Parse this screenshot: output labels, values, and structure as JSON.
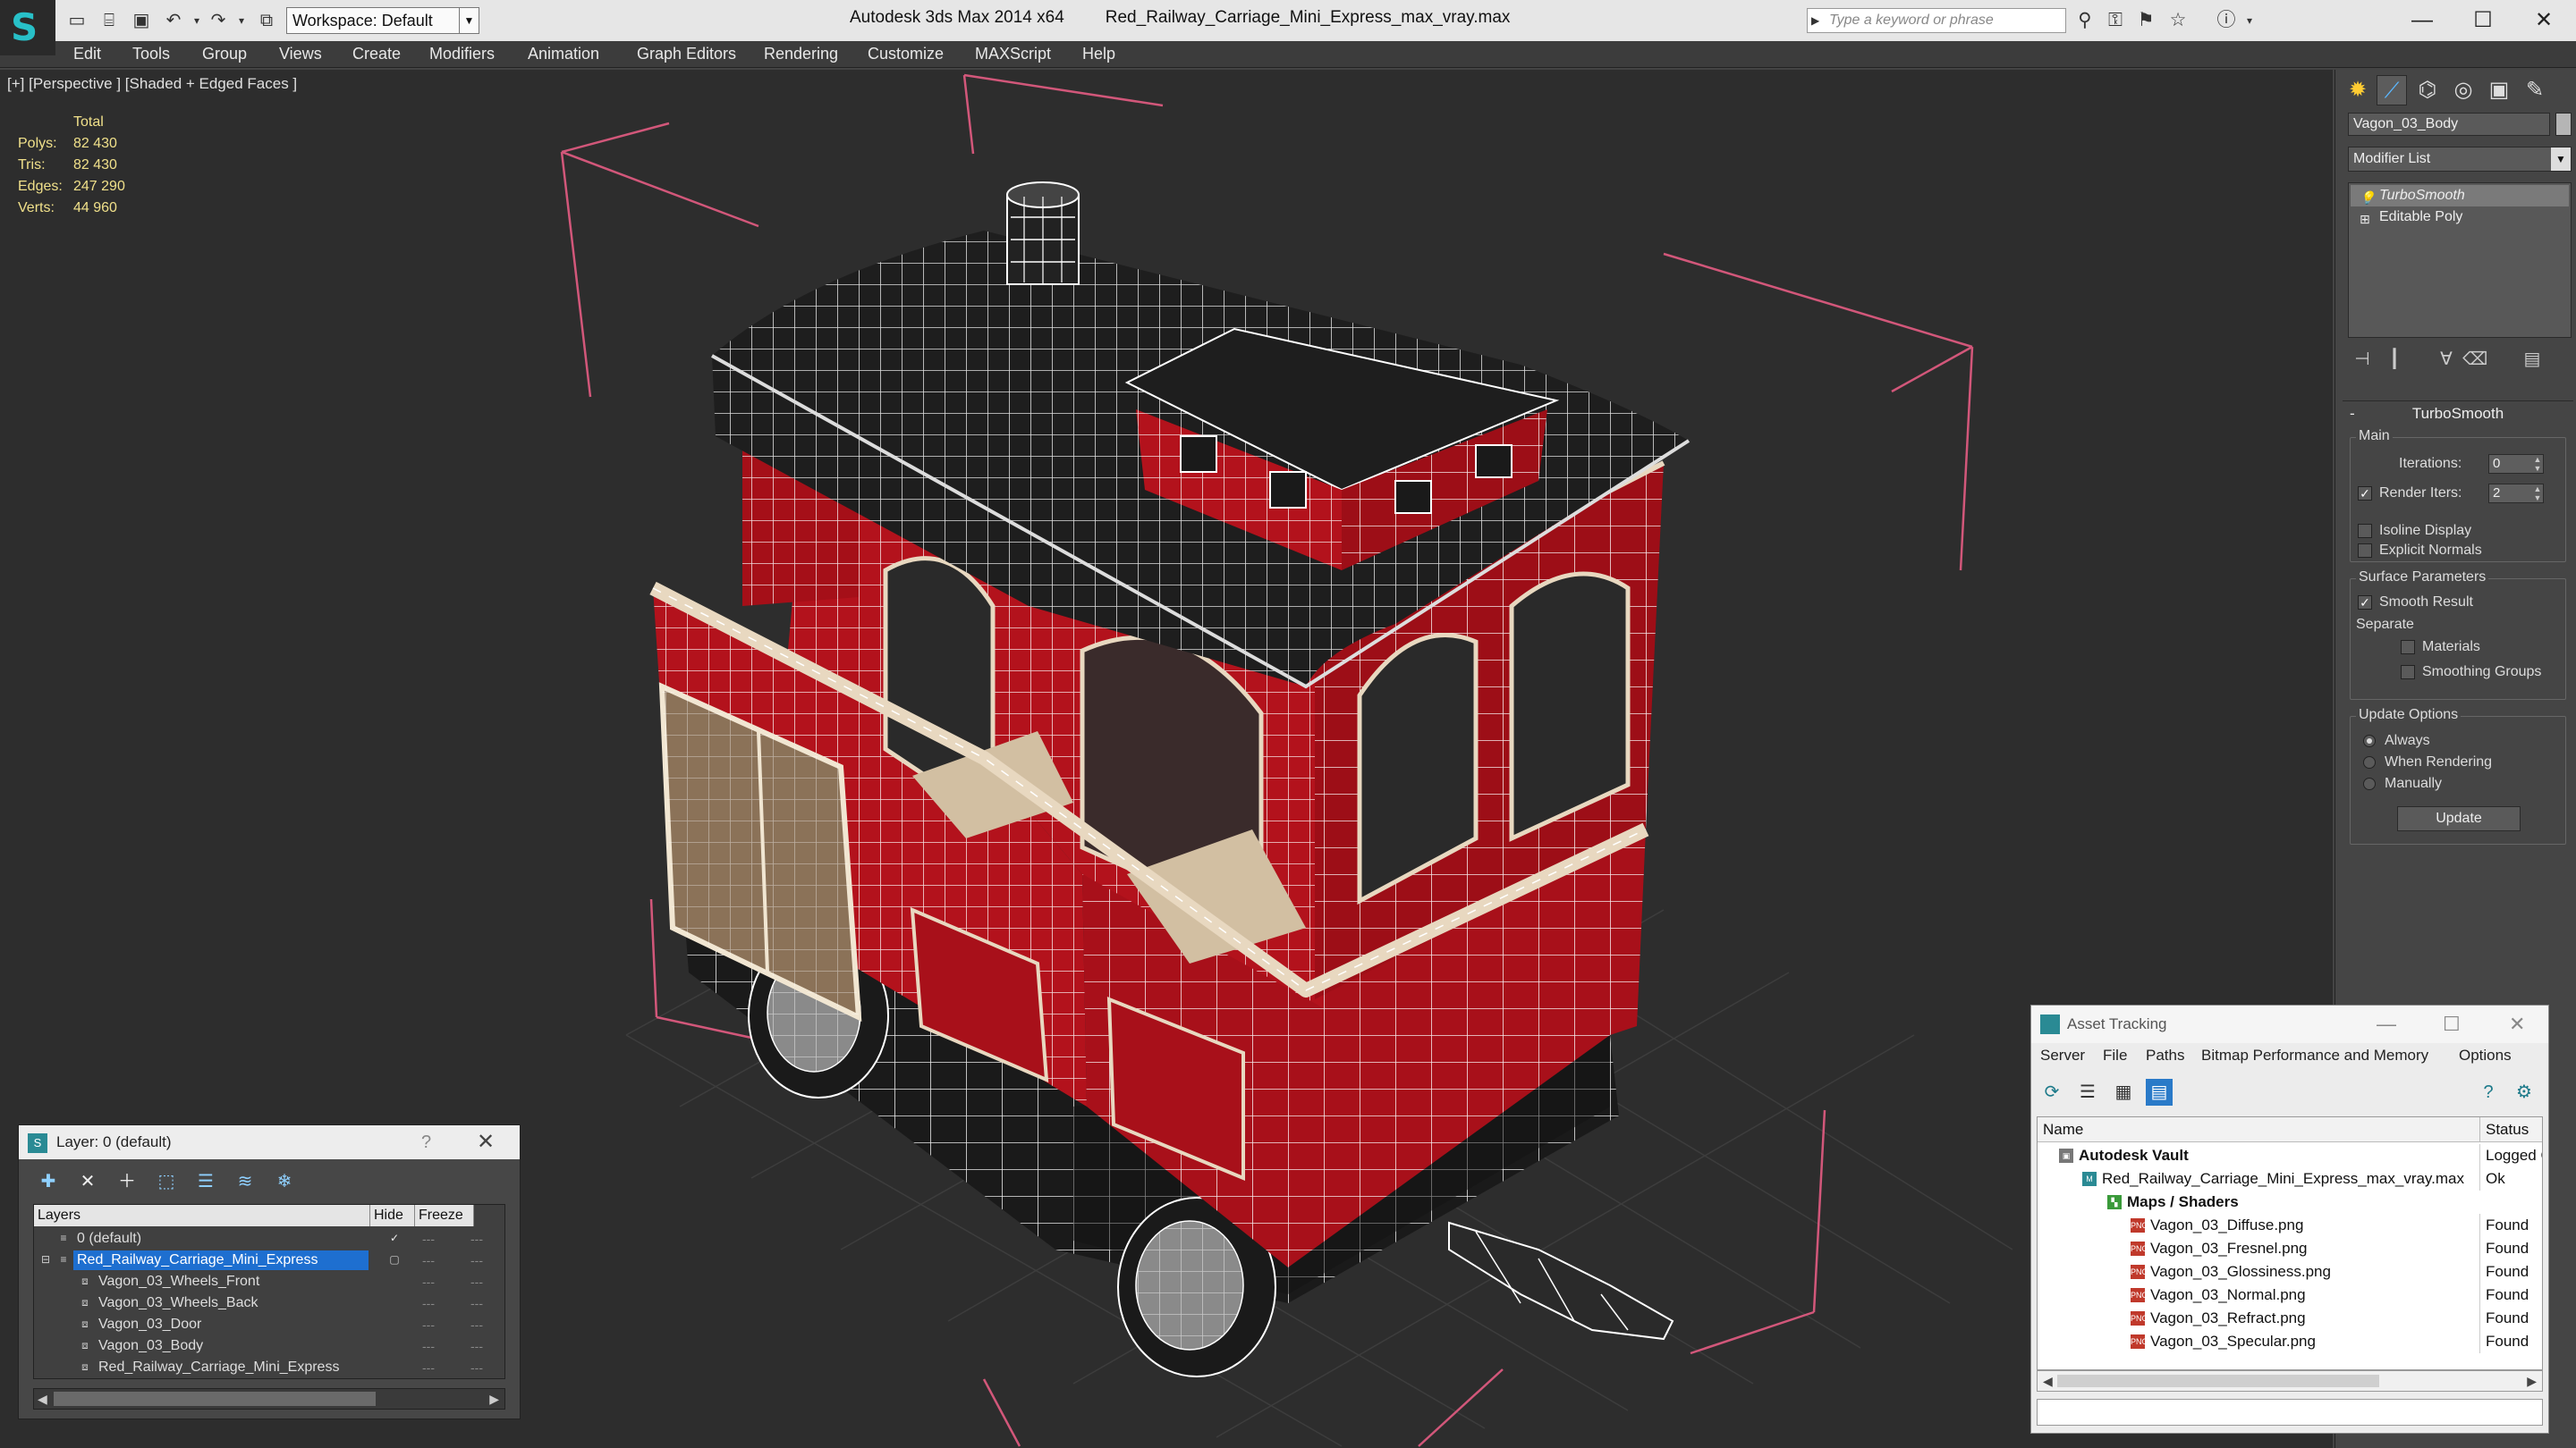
{
  "app": {
    "title_app": "Autodesk 3ds Max  2014 x64",
    "title_file": "Red_Railway_Carriage_Mini_Express_max_vray.max",
    "workspace": "Workspace: Default",
    "search_placeholder": "Type a keyword or phrase"
  },
  "menu": [
    "Edit",
    "Tools",
    "Group",
    "Views",
    "Create",
    "Modifiers",
    "Animation",
    "Graph Editors",
    "Rendering",
    "Customize",
    "MAXScript",
    "Help"
  ],
  "viewport": {
    "label": "[+] [Perspective ] [Shaded + Edged Faces ]",
    "stats_header": "Total",
    "stats": [
      {
        "key": "Polys:",
        "value": "82 430"
      },
      {
        "key": "Tris:",
        "value": "82 430"
      },
      {
        "key": "Edges:",
        "value": "247 290"
      },
      {
        "key": "Verts:",
        "value": "44 960"
      }
    ]
  },
  "command_panel": {
    "object_name": "Vagon_03_Body",
    "modifier_list": "Modifier List",
    "stack": [
      {
        "label": "TurboSmooth",
        "selected": true
      },
      {
        "label": "Editable Poly",
        "selected": false
      }
    ],
    "rollout_title": "TurboSmooth",
    "main_group": "Main",
    "iterations_label": "Iterations:",
    "iterations_value": "0",
    "render_iters_label": "Render Iters:",
    "render_iters_value": "2",
    "isoline_label": "Isoline Display",
    "explicit_label": "Explicit Normals",
    "surface_group": "Surface Parameters",
    "smooth_label": "Smooth Result",
    "separate_label": "Separate",
    "materials_label": "Materials",
    "smoothing_groups_label": "Smoothing Groups",
    "update_group": "Update Options",
    "always_label": "Always",
    "when_rendering_label": "When Rendering",
    "manually_label": "Manually",
    "update_button": "Update"
  },
  "layer_window": {
    "title": "Layer: 0 (default)",
    "help": "?",
    "col_layers": "Layers",
    "col_hide": "Hide",
    "col_freeze": "Freeze",
    "rows": [
      {
        "name": "0 (default)",
        "indent": 0,
        "selected": false
      },
      {
        "name": "Red_Railway_Carriage_Mini_Express",
        "indent": 0,
        "selected": true
      },
      {
        "name": "Vagon_03_Wheels_Front",
        "indent": 1,
        "selected": false
      },
      {
        "name": "Vagon_03_Wheels_Back",
        "indent": 1,
        "selected": false
      },
      {
        "name": "Vagon_03_Door",
        "indent": 1,
        "selected": false
      },
      {
        "name": "Vagon_03_Body",
        "indent": 1,
        "selected": false
      },
      {
        "name": "Red_Railway_Carriage_Mini_Express",
        "indent": 1,
        "selected": false
      }
    ]
  },
  "asset_window": {
    "title": "Asset Tracking",
    "menu": [
      "Server",
      "File",
      "Paths",
      "Bitmap Performance and Memory",
      "Options"
    ],
    "col_name": "Name",
    "col_status": "Status",
    "rows": [
      {
        "name": "Autodesk Vault",
        "status": "Logged C",
        "level": 0
      },
      {
        "name": "Red_Railway_Carriage_Mini_Express_max_vray.max",
        "status": "Ok",
        "level": 1
      },
      {
        "name": "Maps / Shaders",
        "status": "",
        "level": 2
      },
      {
        "name": "Vagon_03_Diffuse.png",
        "status": "Found",
        "level": 3
      },
      {
        "name": "Vagon_03_Fresnel.png",
        "status": "Found",
        "level": 3
      },
      {
        "name": "Vagon_03_Glossiness.png",
        "status": "Found",
        "level": 3
      },
      {
        "name": "Vagon_03_Normal.png",
        "status": "Found",
        "level": 3
      },
      {
        "name": "Vagon_03_Refract.png",
        "status": "Found",
        "level": 3
      },
      {
        "name": "Vagon_03_Specular.png",
        "status": "Found",
        "level": 3
      }
    ]
  },
  "colors": {
    "selection_bracket": "#d2577a",
    "carriage_red": "#b3121c",
    "roof": "#1e1e1e",
    "wood": "#b9a58a",
    "wire": "#ffffff",
    "stats_text": "#f0e08a",
    "layer_selected": "#1e6fd0"
  }
}
